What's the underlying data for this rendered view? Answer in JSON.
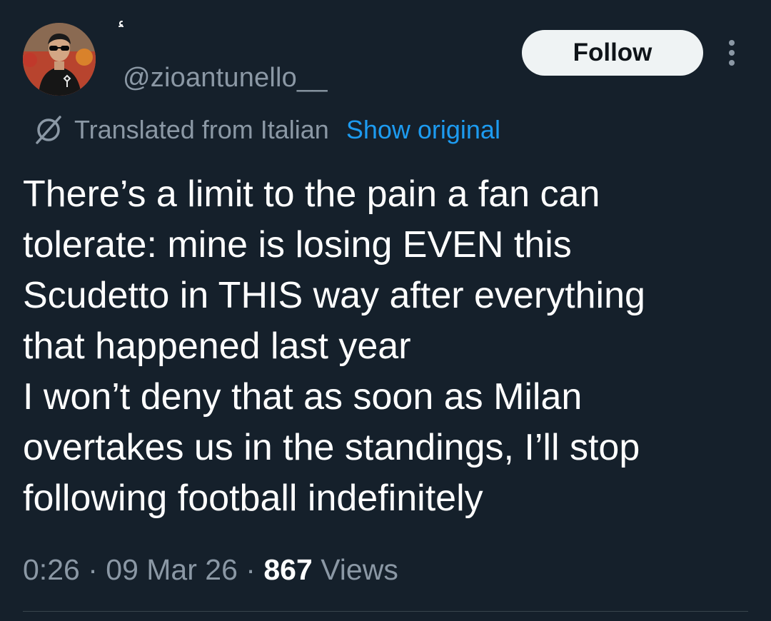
{
  "author": {
    "handle": "@zioantunello__",
    "display_name_glyph": "ء"
  },
  "header": {
    "follow_label": "Follow",
    "more_icon": "more-vertical-icon"
  },
  "translation": {
    "icon": "translate-icon",
    "label": "Translated from Italian",
    "show_original_label": "Show original"
  },
  "tweet": {
    "lines": [
      "There’s a limit to the pain a fan can",
      "tolerate: mine is losing EVEN this",
      "Scudetto in THIS way after everything",
      "that happened last year",
      "I won’t deny that as soon as Milan",
      "overtakes us in the standings, I’ll stop",
      "following football indefinitely"
    ]
  },
  "meta": {
    "time": "0:26",
    "separator": "·",
    "date": "09 Mar 26",
    "views_count": "867",
    "views_label": "Views"
  },
  "colors": {
    "background": "#15202b",
    "text_primary": "#ffffff",
    "text_secondary": "#8b98a5",
    "link": "#1d9bf0",
    "follow_button_bg": "#eff3f4",
    "divider": "#38444d"
  }
}
